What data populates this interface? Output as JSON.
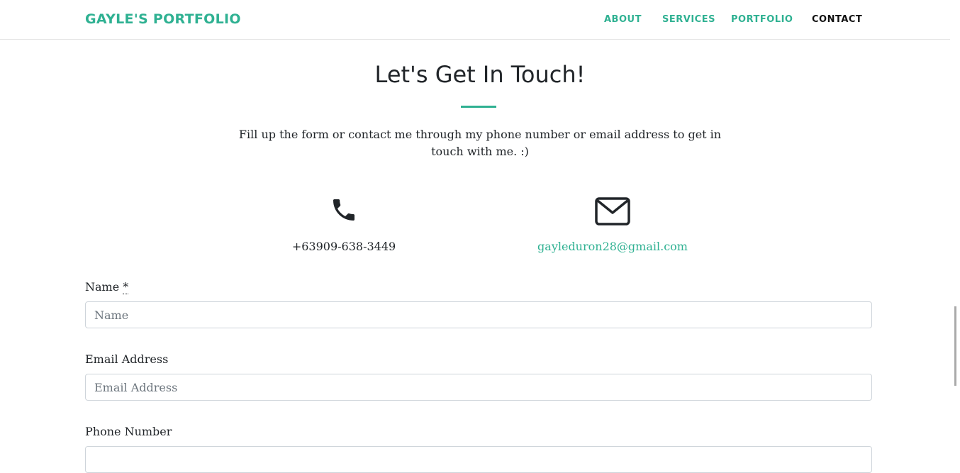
{
  "navbar": {
    "brand": "GAYLE'S PORTFOLIO",
    "links": [
      "ABOUT",
      "SERVICES",
      "PORTFOLIO",
      "CONTACT"
    ],
    "active": "CONTACT"
  },
  "contact": {
    "heading": "Let's Get In Touch!",
    "lead": "Fill up the form or contact me through my phone number or email address to get in touch with me. :)",
    "phone": "+63909-638-3449",
    "email": "gayleduron28@gmail.com",
    "icons": {
      "phone": "phone-icon",
      "email": "envelope-icon"
    }
  },
  "form": {
    "name_label": "Name",
    "required_mark": "*",
    "name_placeholder": "Name",
    "email_label": "Email Address",
    "email_placeholder": "Email Address",
    "phone_label": "Phone Number"
  },
  "colors": {
    "accent": "#2fb192",
    "text": "#212529"
  }
}
